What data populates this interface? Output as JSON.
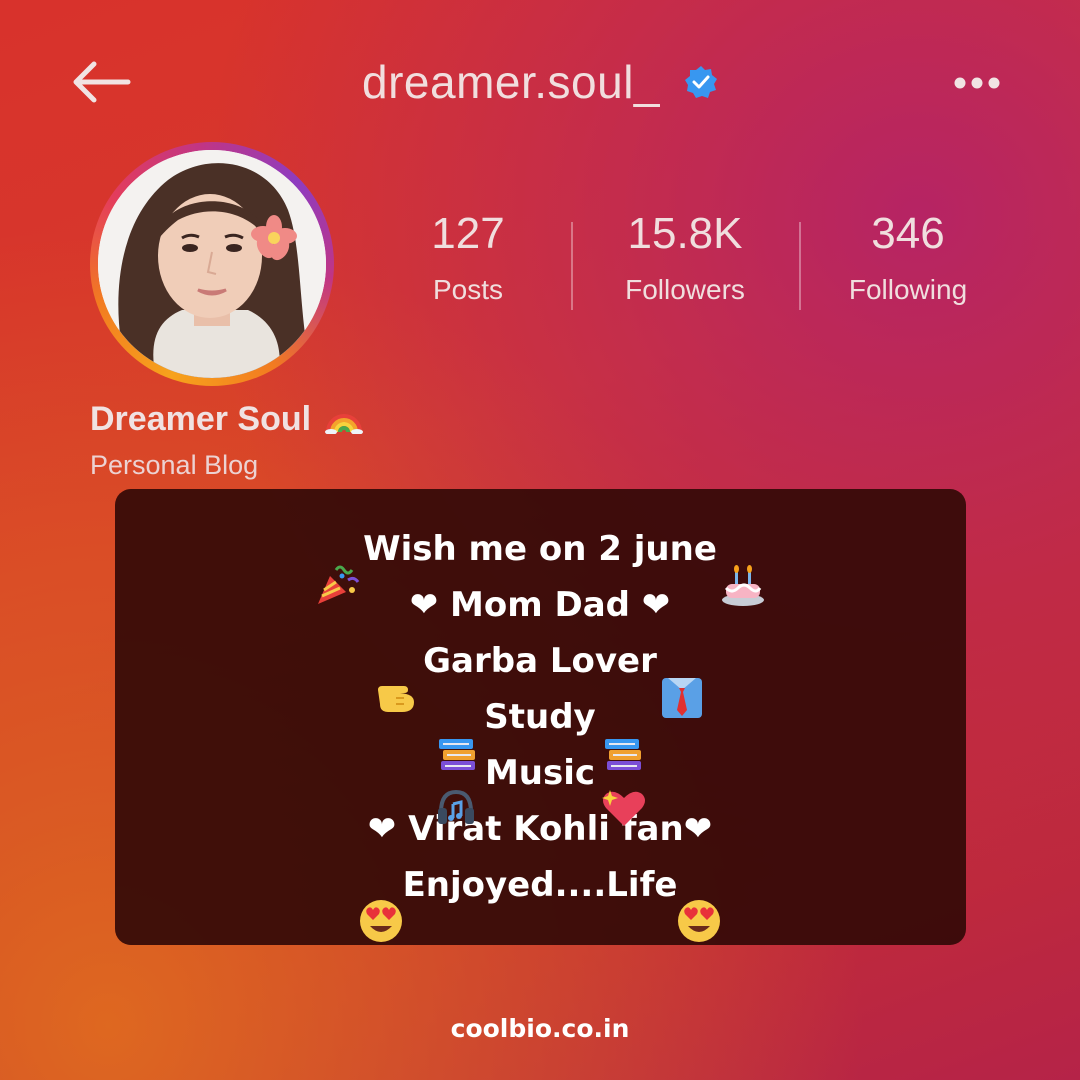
{
  "header": {
    "username": "dreamer.soul_",
    "verified": true,
    "back_icon": "back-arrow-icon",
    "more_icon": "more-dots-icon"
  },
  "profile": {
    "display_name": "Dreamer Soul",
    "name_emoji": "rainbow-emoji",
    "category": "Personal Blog",
    "avatar": "profile-photo"
  },
  "stats": {
    "posts": {
      "value": "127",
      "label": "Posts"
    },
    "followers": {
      "value": "15.8K",
      "label": "Followers"
    },
    "following": {
      "value": "346",
      "label": "Following"
    }
  },
  "bio": {
    "lines": [
      "Wish me on 2 june",
      "❤ Mom Dad ❤",
      "Garba Lover",
      "Study",
      "Music",
      "❤ Virat Kohli fan❤",
      "Enjoyed....Life"
    ],
    "emojis": [
      "party-popper-emoji",
      "birthday-cake-emoji",
      "pointing-hand-emoji",
      "shirt-tie-emoji",
      "books-emoji",
      "headphones-emoji",
      "sparkling-heart-emoji",
      "heart-eyes-emoji"
    ]
  },
  "footer": {
    "site": "coolbio.co.in"
  },
  "colors": {
    "verified_blue": "#3897f0",
    "card_bg": "#340a08"
  }
}
